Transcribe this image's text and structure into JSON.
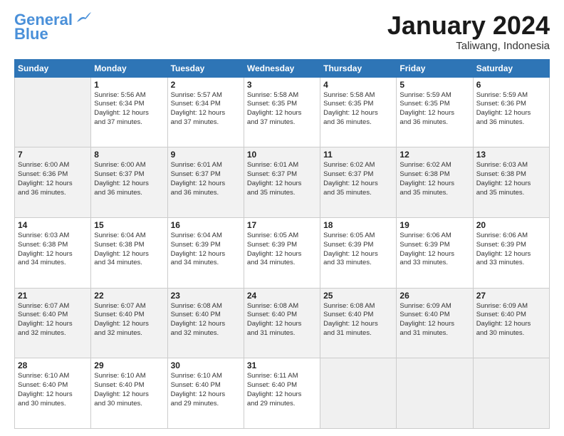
{
  "header": {
    "logo_line1": "General",
    "logo_line2": "Blue",
    "month": "January 2024",
    "location": "Taliwang, Indonesia"
  },
  "days_of_week": [
    "Sunday",
    "Monday",
    "Tuesday",
    "Wednesday",
    "Thursday",
    "Friday",
    "Saturday"
  ],
  "weeks": [
    [
      {
        "day": "",
        "sunrise": "",
        "sunset": "",
        "daylight": ""
      },
      {
        "day": "1",
        "sunrise": "Sunrise: 5:56 AM",
        "sunset": "Sunset: 6:34 PM",
        "daylight": "Daylight: 12 hours and 37 minutes."
      },
      {
        "day": "2",
        "sunrise": "Sunrise: 5:57 AM",
        "sunset": "Sunset: 6:34 PM",
        "daylight": "Daylight: 12 hours and 37 minutes."
      },
      {
        "day": "3",
        "sunrise": "Sunrise: 5:58 AM",
        "sunset": "Sunset: 6:35 PM",
        "daylight": "Daylight: 12 hours and 37 minutes."
      },
      {
        "day": "4",
        "sunrise": "Sunrise: 5:58 AM",
        "sunset": "Sunset: 6:35 PM",
        "daylight": "Daylight: 12 hours and 36 minutes."
      },
      {
        "day": "5",
        "sunrise": "Sunrise: 5:59 AM",
        "sunset": "Sunset: 6:35 PM",
        "daylight": "Daylight: 12 hours and 36 minutes."
      },
      {
        "day": "6",
        "sunrise": "Sunrise: 5:59 AM",
        "sunset": "Sunset: 6:36 PM",
        "daylight": "Daylight: 12 hours and 36 minutes."
      }
    ],
    [
      {
        "day": "7",
        "sunrise": "Sunrise: 6:00 AM",
        "sunset": "Sunset: 6:36 PM",
        "daylight": "Daylight: 12 hours and 36 minutes."
      },
      {
        "day": "8",
        "sunrise": "Sunrise: 6:00 AM",
        "sunset": "Sunset: 6:37 PM",
        "daylight": "Daylight: 12 hours and 36 minutes."
      },
      {
        "day": "9",
        "sunrise": "Sunrise: 6:01 AM",
        "sunset": "Sunset: 6:37 PM",
        "daylight": "Daylight: 12 hours and 36 minutes."
      },
      {
        "day": "10",
        "sunrise": "Sunrise: 6:01 AM",
        "sunset": "Sunset: 6:37 PM",
        "daylight": "Daylight: 12 hours and 35 minutes."
      },
      {
        "day": "11",
        "sunrise": "Sunrise: 6:02 AM",
        "sunset": "Sunset: 6:37 PM",
        "daylight": "Daylight: 12 hours and 35 minutes."
      },
      {
        "day": "12",
        "sunrise": "Sunrise: 6:02 AM",
        "sunset": "Sunset: 6:38 PM",
        "daylight": "Daylight: 12 hours and 35 minutes."
      },
      {
        "day": "13",
        "sunrise": "Sunrise: 6:03 AM",
        "sunset": "Sunset: 6:38 PM",
        "daylight": "Daylight: 12 hours and 35 minutes."
      }
    ],
    [
      {
        "day": "14",
        "sunrise": "Sunrise: 6:03 AM",
        "sunset": "Sunset: 6:38 PM",
        "daylight": "Daylight: 12 hours and 34 minutes."
      },
      {
        "day": "15",
        "sunrise": "Sunrise: 6:04 AM",
        "sunset": "Sunset: 6:38 PM",
        "daylight": "Daylight: 12 hours and 34 minutes."
      },
      {
        "day": "16",
        "sunrise": "Sunrise: 6:04 AM",
        "sunset": "Sunset: 6:39 PM",
        "daylight": "Daylight: 12 hours and 34 minutes."
      },
      {
        "day": "17",
        "sunrise": "Sunrise: 6:05 AM",
        "sunset": "Sunset: 6:39 PM",
        "daylight": "Daylight: 12 hours and 34 minutes."
      },
      {
        "day": "18",
        "sunrise": "Sunrise: 6:05 AM",
        "sunset": "Sunset: 6:39 PM",
        "daylight": "Daylight: 12 hours and 33 minutes."
      },
      {
        "day": "19",
        "sunrise": "Sunrise: 6:06 AM",
        "sunset": "Sunset: 6:39 PM",
        "daylight": "Daylight: 12 hours and 33 minutes."
      },
      {
        "day": "20",
        "sunrise": "Sunrise: 6:06 AM",
        "sunset": "Sunset: 6:39 PM",
        "daylight": "Daylight: 12 hours and 33 minutes."
      }
    ],
    [
      {
        "day": "21",
        "sunrise": "Sunrise: 6:07 AM",
        "sunset": "Sunset: 6:40 PM",
        "daylight": "Daylight: 12 hours and 32 minutes."
      },
      {
        "day": "22",
        "sunrise": "Sunrise: 6:07 AM",
        "sunset": "Sunset: 6:40 PM",
        "daylight": "Daylight: 12 hours and 32 minutes."
      },
      {
        "day": "23",
        "sunrise": "Sunrise: 6:08 AM",
        "sunset": "Sunset: 6:40 PM",
        "daylight": "Daylight: 12 hours and 32 minutes."
      },
      {
        "day": "24",
        "sunrise": "Sunrise: 6:08 AM",
        "sunset": "Sunset: 6:40 PM",
        "daylight": "Daylight: 12 hours and 31 minutes."
      },
      {
        "day": "25",
        "sunrise": "Sunrise: 6:08 AM",
        "sunset": "Sunset: 6:40 PM",
        "daylight": "Daylight: 12 hours and 31 minutes."
      },
      {
        "day": "26",
        "sunrise": "Sunrise: 6:09 AM",
        "sunset": "Sunset: 6:40 PM",
        "daylight": "Daylight: 12 hours and 31 minutes."
      },
      {
        "day": "27",
        "sunrise": "Sunrise: 6:09 AM",
        "sunset": "Sunset: 6:40 PM",
        "daylight": "Daylight: 12 hours and 30 minutes."
      }
    ],
    [
      {
        "day": "28",
        "sunrise": "Sunrise: 6:10 AM",
        "sunset": "Sunset: 6:40 PM",
        "daylight": "Daylight: 12 hours and 30 minutes."
      },
      {
        "day": "29",
        "sunrise": "Sunrise: 6:10 AM",
        "sunset": "Sunset: 6:40 PM",
        "daylight": "Daylight: 12 hours and 30 minutes."
      },
      {
        "day": "30",
        "sunrise": "Sunrise: 6:10 AM",
        "sunset": "Sunset: 6:40 PM",
        "daylight": "Daylight: 12 hours and 29 minutes."
      },
      {
        "day": "31",
        "sunrise": "Sunrise: 6:11 AM",
        "sunset": "Sunset: 6:40 PM",
        "daylight": "Daylight: 12 hours and 29 minutes."
      },
      {
        "day": "",
        "sunrise": "",
        "sunset": "",
        "daylight": ""
      },
      {
        "day": "",
        "sunrise": "",
        "sunset": "",
        "daylight": ""
      },
      {
        "day": "",
        "sunrise": "",
        "sunset": "",
        "daylight": ""
      }
    ]
  ]
}
